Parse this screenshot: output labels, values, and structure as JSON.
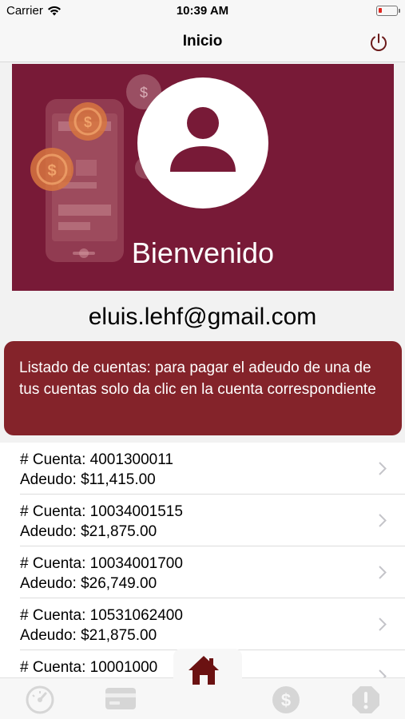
{
  "status_bar": {
    "carrier": "Carrier",
    "time": "10:39 AM"
  },
  "nav": {
    "title": "Inicio"
  },
  "banner": {
    "welcome": "Bienvenido"
  },
  "user": {
    "email": "eluis.lehf@gmail.com"
  },
  "notice": {
    "text": "Listado de cuentas: para pagar el adeudo de una de tus cuentas solo da clic en la cuenta correspondiente"
  },
  "accounts": [
    {
      "number": "# Cuenta: 4001300011",
      "debt": "Adeudo: $11,415.00"
    },
    {
      "number": "# Cuenta: 10034001515",
      "debt": "Adeudo: $21,875.00"
    },
    {
      "number": "# Cuenta: 10034001700",
      "debt": "Adeudo: $26,749.00"
    },
    {
      "number": "# Cuenta: 10531062400",
      "debt": "Adeudo: $21,875.00"
    },
    {
      "number": "# Cuenta: 10001000",
      "debt": ""
    }
  ],
  "tabs": [
    {
      "icon": "gauge-icon"
    },
    {
      "icon": "card-icon"
    },
    {
      "icon": "home-icon"
    },
    {
      "icon": "dollar-icon"
    },
    {
      "icon": "alert-icon"
    }
  ],
  "colors": {
    "brand": "#781a37",
    "notice": "#84232a",
    "tab_inactive": "#d6d6d6",
    "home_active": "#6b1212"
  }
}
